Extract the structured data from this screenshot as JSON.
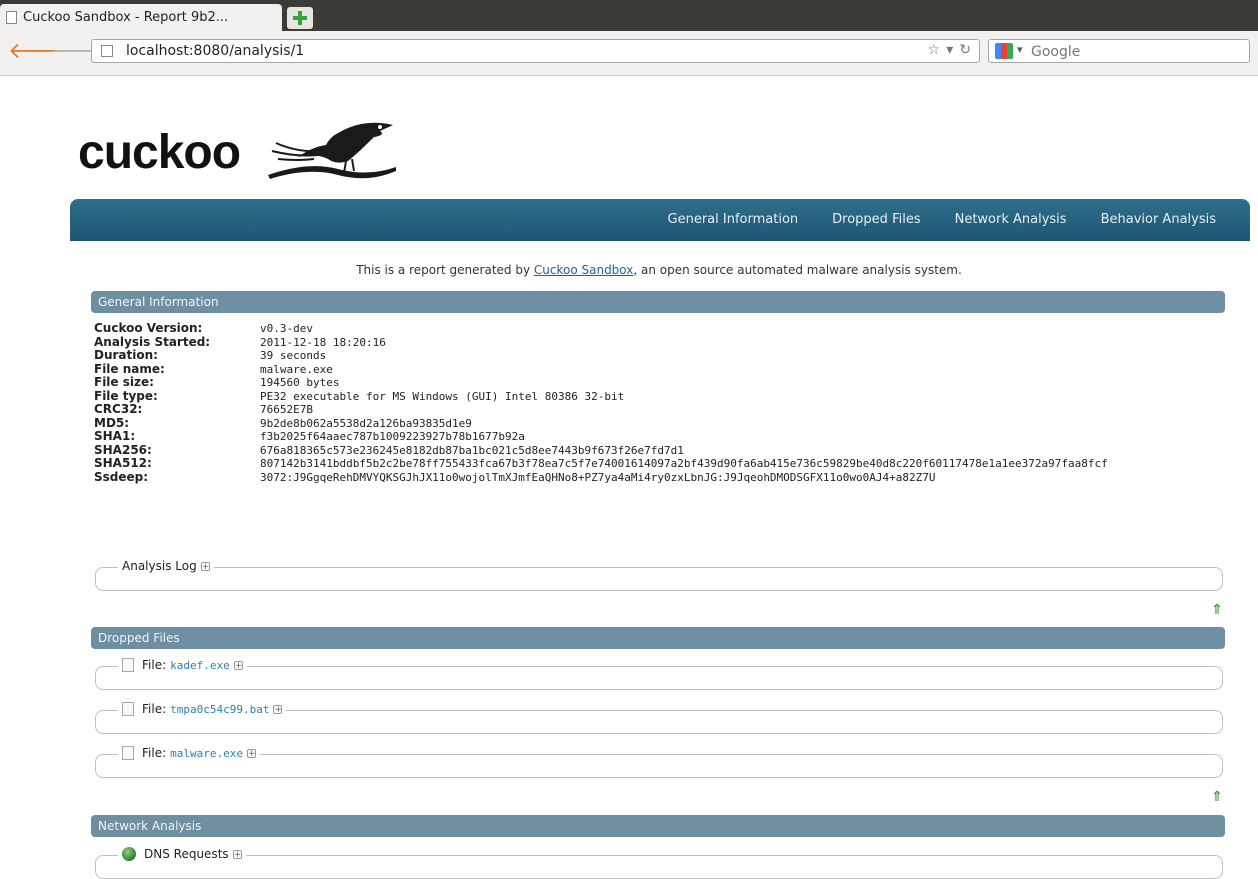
{
  "browser": {
    "tab_title": "Cuckoo Sandbox - Report 9b2...",
    "url": "localhost:8080/analysis/1",
    "search_placeholder": "Google"
  },
  "logo_text": "cuckoo",
  "nav": {
    "items": [
      "General Information",
      "Dropped Files",
      "Network Analysis",
      "Behavior Analysis"
    ]
  },
  "intro": {
    "prefix": "This is a report generated by ",
    "link": "Cuckoo Sandbox",
    "suffix": ", an open source automated malware analysis system."
  },
  "general": {
    "title": "General Information",
    "rows": [
      {
        "label": "Cuckoo Version:",
        "value": "v0.3-dev"
      },
      {
        "label": "Analysis Started:",
        "value": "2011-12-18 18:20:16"
      },
      {
        "label": "Duration:",
        "value": "39 seconds"
      },
      {
        "label": "File name:",
        "value": "malware.exe"
      },
      {
        "label": "File size:",
        "value": "194560 bytes"
      },
      {
        "label": "File type:",
        "value": "PE32 executable for MS Windows (GUI) Intel 80386 32-bit"
      },
      {
        "label": "CRC32:",
        "value": "76652E7B"
      },
      {
        "label": "MD5:",
        "value": "9b2de8b062a5538d2a126ba93835d1e9"
      },
      {
        "label": "SHA1:",
        "value": "f3b2025f64aaec787b1009223927b78b1677b92a"
      },
      {
        "label": "SHA256:",
        "value": "676a818365c573e236245e8182db87ba1bc021c5d8ee7443b9f673f26e7fd7d1"
      },
      {
        "label": "SHA512:",
        "value": "807142b3141bddbf5b2c2be78ff755433fca67b3f78ea7c5f7e74001614097a2bf439d90fa6ab415e736c59829be40d8c220f60117478e1a1ee372a97faa8fcf"
      },
      {
        "label": "Ssdeep:",
        "value": "3072:J9GgqeRehDMVYQKSGJhJX11o0wojolTmXJmfEaQHNo8+PZ7ya4aMi4ry0zxLbnJG:J9JqeohDMODSGFX11o0wo0AJ4+a82Z7U"
      }
    ],
    "analysis_log_label": "Analysis Log"
  },
  "dropped": {
    "title": "Dropped Files",
    "file_prefix": "File:",
    "files": [
      "kadef.exe",
      "tmpa0c54c99.bat",
      "malware.exe"
    ]
  },
  "network": {
    "title": "Network Analysis",
    "dns_label": "DNS Requests"
  },
  "icons": {
    "back": "arrow-left",
    "forward": "arrow-right",
    "star": "star",
    "reload": "reload",
    "top": "up-arrow",
    "expand": "plus-box"
  }
}
